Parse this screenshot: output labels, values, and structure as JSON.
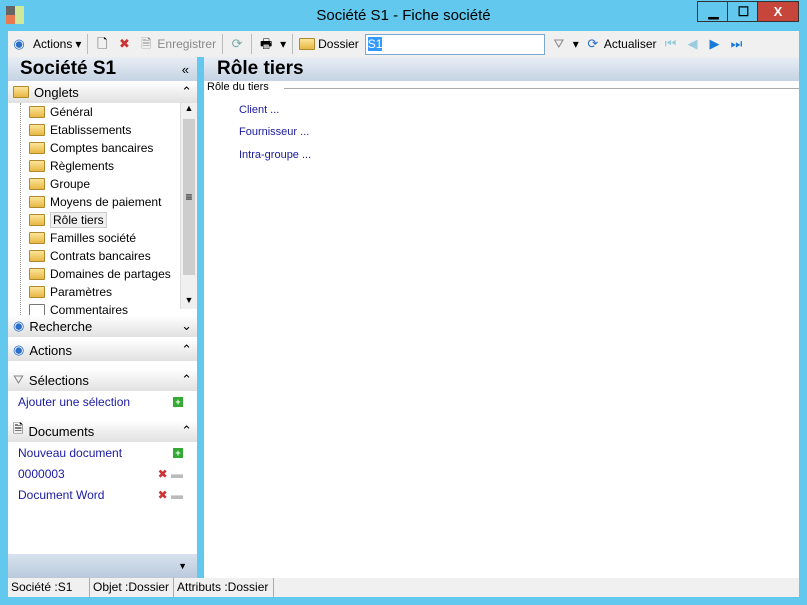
{
  "window": {
    "title": "Société S1 -  Fiche société",
    "minimize": "▁",
    "maximize": "☐",
    "close": "X"
  },
  "toolbar": {
    "actions": "Actions",
    "save": "Enregistrer",
    "dossier": "Dossier",
    "dossier_value": "S1",
    "refresh": "Actualiser"
  },
  "left": {
    "title": "Société S1",
    "onglets": "Onglets",
    "tabs": [
      "Général",
      "Etablissements",
      "Comptes bancaires",
      "Règlements",
      "Groupe",
      "Moyens de paiement",
      "Rôle tiers",
      "Familles société",
      "Contrats bancaires",
      "Domaines de partages",
      "Paramètres",
      "Commentaires"
    ],
    "recherche": "Recherche",
    "actions": "Actions",
    "selections": "Sélections",
    "add_selection": "Ajouter une sélection",
    "documents": "Documents",
    "new_document": "Nouveau document",
    "docs": [
      "0000003",
      "Document Word"
    ]
  },
  "main": {
    "title": "Rôle tiers",
    "group": "Rôle du tiers",
    "links": [
      "Client ...",
      "Fournisseur ...",
      "Intra-groupe ..."
    ]
  },
  "status": {
    "societe": "Société :S1",
    "objet": "Objet :Dossier",
    "attributs": "Attributs :Dossier"
  }
}
